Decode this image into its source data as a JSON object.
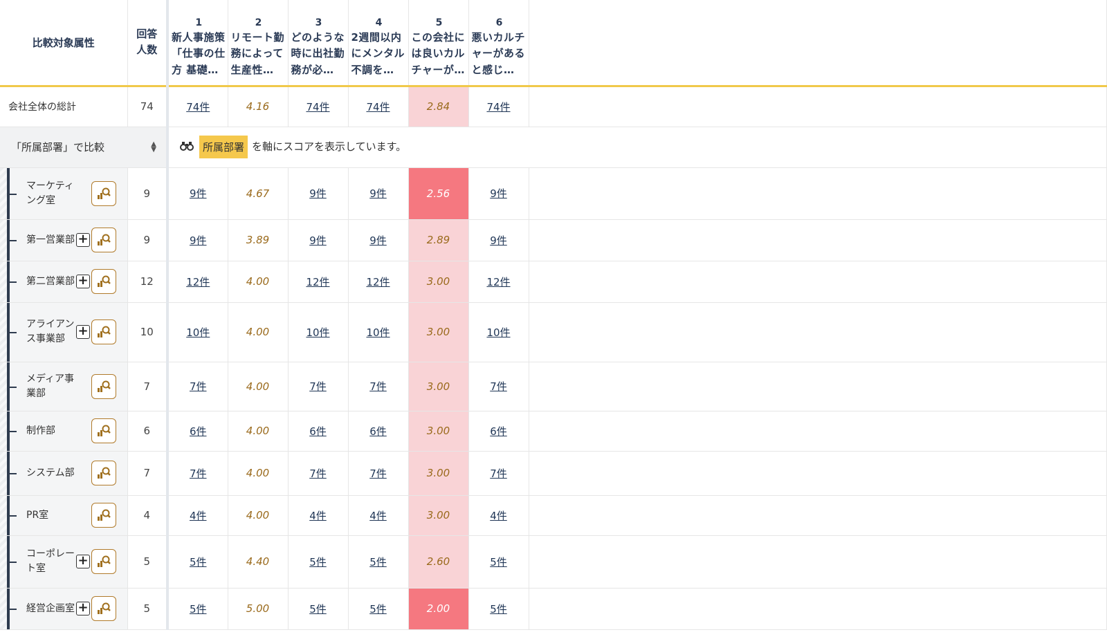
{
  "header": {
    "attr_label": "比較対象属性",
    "count_label_1": "回答",
    "count_label_2": "人数",
    "questions": [
      {
        "num": "1",
        "text": "新人事施策「仕事の仕方 基礎…"
      },
      {
        "num": "2",
        "text": "リモート勤務によって生産性…"
      },
      {
        "num": "3",
        "text": "どのような時に出社勤務が必…"
      },
      {
        "num": "4",
        "text": "2週間以内にメンタル不調を…"
      },
      {
        "num": "5",
        "text": "この会社には良いカルチャーが…"
      },
      {
        "num": "6",
        "text": "悪いカルチャーがあると感じ…"
      }
    ]
  },
  "total": {
    "label": "会社全体の総計",
    "count": "74",
    "cells": [
      "74件",
      "4.16",
      "74件",
      "74件",
      "2.84",
      "74件"
    ]
  },
  "compare": {
    "selector_label": "「所属部署」で比較",
    "sort_icon": "sort-updown-icon",
    "binoculars_icon": "binoculars-icon",
    "axis_tag": "所属部署",
    "info_text": "を軸にスコアを表示しています。"
  },
  "colors": {
    "accent_border": "#f0c94a",
    "tag": "#f5c84c",
    "score_text": "#9a6a1c",
    "pink": "#f9d3d6",
    "red": "#f57880",
    "link": "#1f3555"
  },
  "depts": [
    {
      "name": "マーケティング室",
      "count": "9",
      "c1": "9件",
      "s2": "4.67",
      "c3": "9件",
      "c4": "9件",
      "s5": "2.56",
      "c6": "9件",
      "s5_level": "red",
      "expandable": false
    },
    {
      "name": "第一営業部",
      "count": "9",
      "c1": "9件",
      "s2": "3.89",
      "c3": "9件",
      "c4": "9件",
      "s5": "2.89",
      "c6": "9件",
      "s5_level": "pink",
      "expandable": true
    },
    {
      "name": "第二営業部",
      "count": "12",
      "c1": "12件",
      "s2": "4.00",
      "c3": "12件",
      "c4": "12件",
      "s5": "3.00",
      "c6": "12件",
      "s5_level": "pink",
      "expandable": true
    },
    {
      "name": "アライアンス事業部",
      "count": "10",
      "c1": "10件",
      "s2": "4.00",
      "c3": "10件",
      "c4": "10件",
      "s5": "3.00",
      "c6": "10件",
      "s5_level": "pink",
      "expandable": true
    },
    {
      "name": "メディア事業部",
      "count": "7",
      "c1": "7件",
      "s2": "4.00",
      "c3": "7件",
      "c4": "7件",
      "s5": "3.00",
      "c6": "7件",
      "s5_level": "pink",
      "expandable": false
    },
    {
      "name": "制作部",
      "count": "6",
      "c1": "6件",
      "s2": "4.00",
      "c3": "6件",
      "c4": "6件",
      "s5": "3.00",
      "c6": "6件",
      "s5_level": "pink",
      "expandable": false
    },
    {
      "name": "システム部",
      "count": "7",
      "c1": "7件",
      "s2": "4.00",
      "c3": "7件",
      "c4": "7件",
      "s5": "3.00",
      "c6": "7件",
      "s5_level": "pink",
      "expandable": false
    },
    {
      "name": "PR室",
      "count": "4",
      "c1": "4件",
      "s2": "4.00",
      "c3": "4件",
      "c4": "4件",
      "s5": "3.00",
      "c6": "4件",
      "s5_level": "pink",
      "expandable": false
    },
    {
      "name": "コーポレート室",
      "count": "5",
      "c1": "5件",
      "s2": "4.40",
      "c3": "5件",
      "c4": "5件",
      "s5": "2.60",
      "c6": "5件",
      "s5_level": "pink",
      "expandable": true
    },
    {
      "name": "経営企画室",
      "count": "5",
      "c1": "5件",
      "s2": "5.00",
      "c3": "5件",
      "c4": "5件",
      "s5": "2.00",
      "c6": "5件",
      "s5_level": "red",
      "expandable": true
    }
  ]
}
